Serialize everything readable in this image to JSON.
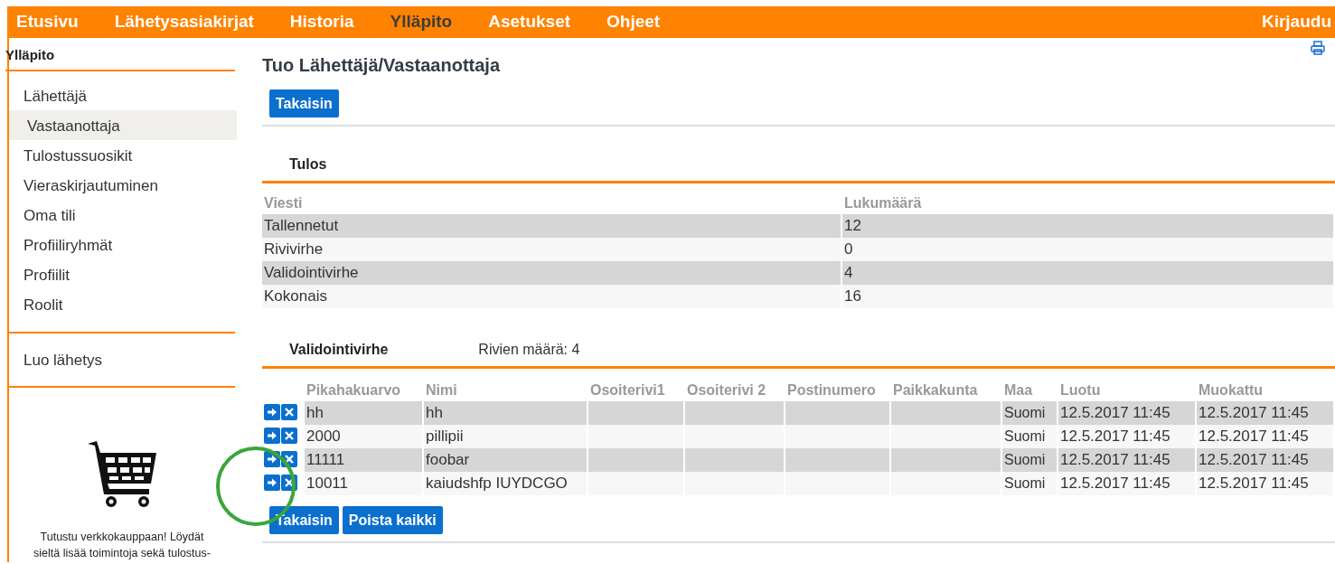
{
  "nav": {
    "items": [
      {
        "label": "Etusivu",
        "selected": false
      },
      {
        "label": "Lähetysasiakirjat",
        "selected": false
      },
      {
        "label": "Historia",
        "selected": false
      },
      {
        "label": "Ylläpito",
        "selected": true
      },
      {
        "label": "Asetukset",
        "selected": false
      },
      {
        "label": "Ohjeet",
        "selected": false
      }
    ],
    "login": "Kirjaudu"
  },
  "sidebar": {
    "title": "Ylläpito",
    "items": [
      {
        "label": "Lähettäjä",
        "selected": false
      },
      {
        "label": "Vastaanottaja",
        "selected": true
      },
      {
        "label": "Tulostussuosikit",
        "selected": false
      },
      {
        "label": "Vieraskirjautuminen",
        "selected": false
      },
      {
        "label": "Oma tili",
        "selected": false
      },
      {
        "label": "Profiiliryhmät",
        "selected": false
      },
      {
        "label": "Profiilit",
        "selected": false
      },
      {
        "label": "Roolit",
        "selected": false
      }
    ],
    "extra_items": [
      {
        "label": "Luo lähetys"
      }
    ],
    "promo": [
      "Tutustu verkkokauppaan! Löydät",
      "sieltä lisää toimintoja sekä tulostus-"
    ]
  },
  "page": {
    "title": "Tuo Lähettäjä/Vastaanottaja",
    "back_button": "Takaisin"
  },
  "result": {
    "title": "Tulos",
    "columns": [
      "Viesti",
      "Lukumäärä"
    ],
    "rows": [
      [
        "Tallennetut",
        "12"
      ],
      [
        "Rivivirhe",
        "0"
      ],
      [
        "Validointivirhe",
        "4"
      ],
      [
        "Kokonais",
        "16"
      ]
    ]
  },
  "errors": {
    "title": "Validointivirhe",
    "count_label": "Rivien määrä: 4",
    "columns": [
      "Pikahakuarvo",
      "Nimi",
      "Osoiterivi1",
      "Osoiterivi 2",
      "Postinumero",
      "Paikkakunta",
      "Maa",
      "Luotu",
      "Muokattu"
    ],
    "rows": [
      {
        "code": "hh",
        "name": "hh",
        "country": "Suomi",
        "created": "12.5.2017 11:45",
        "modified": "12.5.2017 11:45"
      },
      {
        "code": "2000",
        "name": "pillipii",
        "country": "Suomi",
        "created": "12.5.2017 11:45",
        "modified": "12.5.2017 11:45"
      },
      {
        "code": "11111",
        "name": "foobar",
        "country": "Suomi",
        "created": "12.5.2017 11:45",
        "modified": "12.5.2017 11:45"
      },
      {
        "code": "10011",
        "name": "kaiudshfp IUYDCGO",
        "country": "Suomi",
        "created": "12.5.2017 11:45",
        "modified": "12.5.2017 11:45"
      }
    ],
    "buttons": [
      "Takaisin",
      "Poista kaikki"
    ]
  }
}
